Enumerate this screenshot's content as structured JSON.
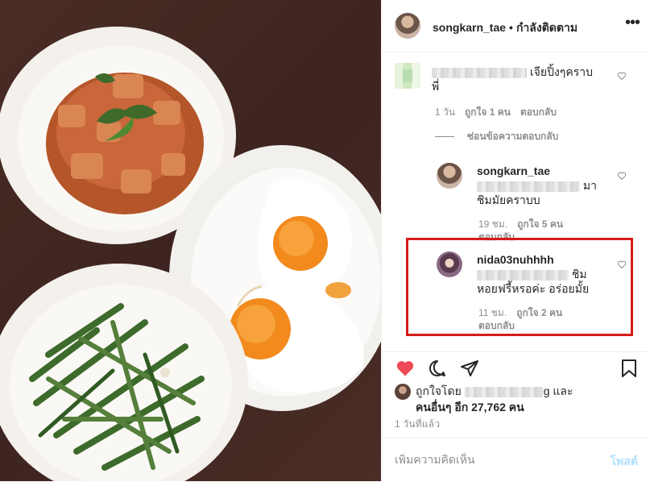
{
  "header": {
    "username": "songkarn_tae",
    "separator": "•",
    "follow_status": "กำลังติดตาม",
    "more_label": "•••"
  },
  "comments": [
    {
      "text_line1": "เจียปิ้งๆคราบ",
      "text_line2": "พี่",
      "time": "1 วัน",
      "likes": "ถูกใจ 1 คน",
      "reply": "ตอบกลับ"
    }
  ],
  "hide_replies": "ซ่อนข้อความตอบกลับ",
  "replies": [
    {
      "username": "songkarn_tae",
      "text_line1": "มา",
      "text_line2": "ชิมมัยคราบบ",
      "time": "19 ชม.",
      "likes": "ถูกใจ 5 คน",
      "reply": "ตอบกลับ"
    },
    {
      "username": "nida03nuhhhh",
      "text_line1": "ชิม",
      "text_line2": "หอยฟรี้หรอค่ะ อร่อยมั้ย",
      "time": "11 ชม.",
      "likes": "ถูกใจ 2 คน",
      "reply": "ตอบกลับ"
    }
  ],
  "liked_by": {
    "prefix": "ถูกใจโดย",
    "name_suffix": "g",
    "and": "และ",
    "others": "คนอื่นๆ อีก 27,762 คน"
  },
  "time_ago": "1 วันที่แล้ว",
  "comment_input": {
    "placeholder": "เพิ่มความคิดเห็น",
    "post_label": "โพสต์"
  },
  "colors": {
    "liked_heart": "#ed4956",
    "highlight_border": "#d51b1b",
    "post_button": "#b2dffc"
  },
  "icons": [
    "heart-filled-icon",
    "comment-icon",
    "share-icon",
    "bookmark-icon",
    "heart-outline-icon"
  ]
}
